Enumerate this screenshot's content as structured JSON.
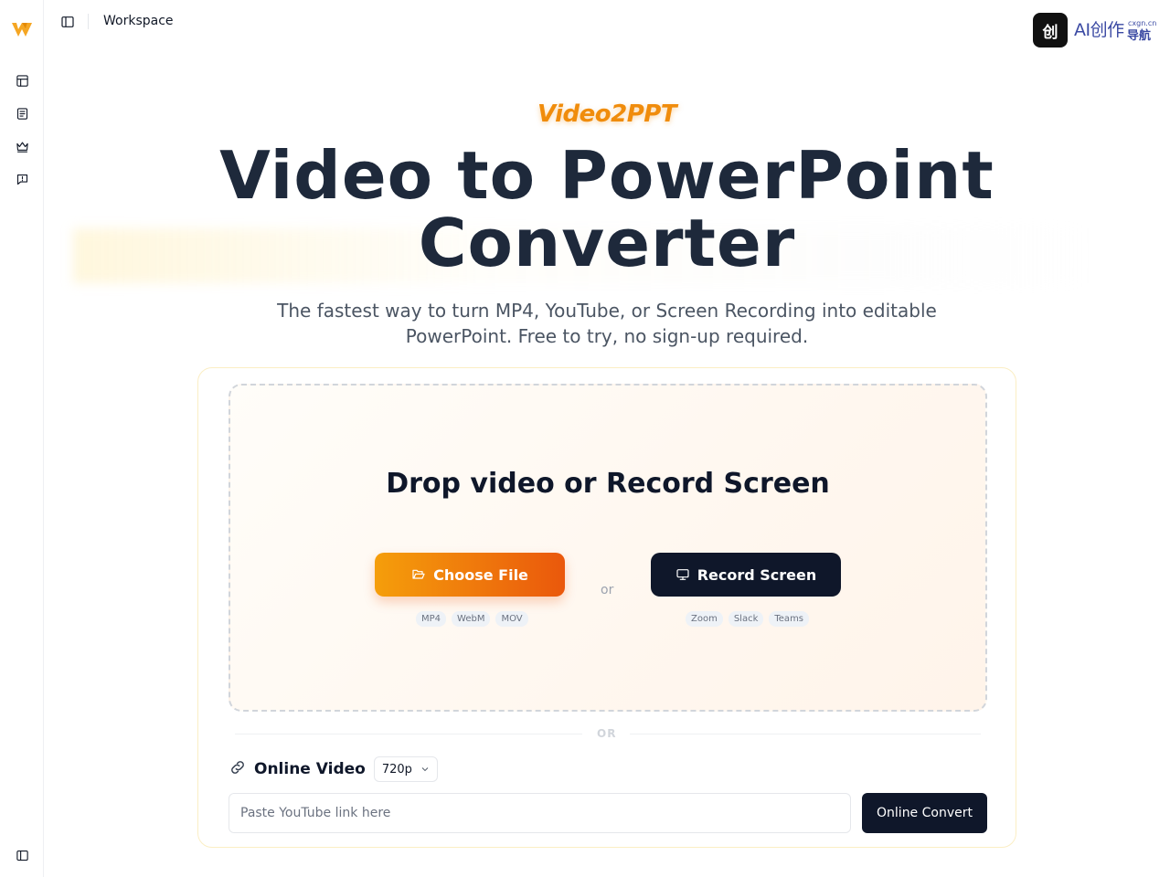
{
  "header": {
    "workspace_label": "Workspace",
    "brand_badge_text": "创",
    "brand_text": "AI创作",
    "brand_sub": "cxgn.cn",
    "brand_sub2": "导航"
  },
  "sidebar": {
    "items": [
      {
        "icon": "layout-icon"
      },
      {
        "icon": "document-icon"
      },
      {
        "icon": "crown-icon"
      },
      {
        "icon": "feedback-icon"
      }
    ]
  },
  "hero": {
    "product_name": "Video2PPT",
    "headline_line1": "Video to PowerPoint",
    "headline_line2": "Converter",
    "subhead": "The fastest way to turn MP4, YouTube, or Screen Recording into editable PowerPoint. Free to try, no sign-up required."
  },
  "dropzone": {
    "title": "Drop video or Record Screen",
    "choose_file_label": "Choose File",
    "record_screen_label": "Record Screen",
    "or_label": "or",
    "file_formats": [
      "MP4",
      "WebM",
      "MOV"
    ],
    "record_apps": [
      "Zoom",
      "Slack",
      "Teams"
    ]
  },
  "divider": {
    "label": "OR"
  },
  "online": {
    "label": "Online Video",
    "quality": "720p",
    "input_placeholder": "Paste YouTube link here",
    "input_value": "",
    "convert_label": "Online Convert"
  },
  "colors": {
    "accent_orange": "#f59e0b",
    "accent_deep_orange": "#ea580c",
    "dark": "#0f172a"
  }
}
